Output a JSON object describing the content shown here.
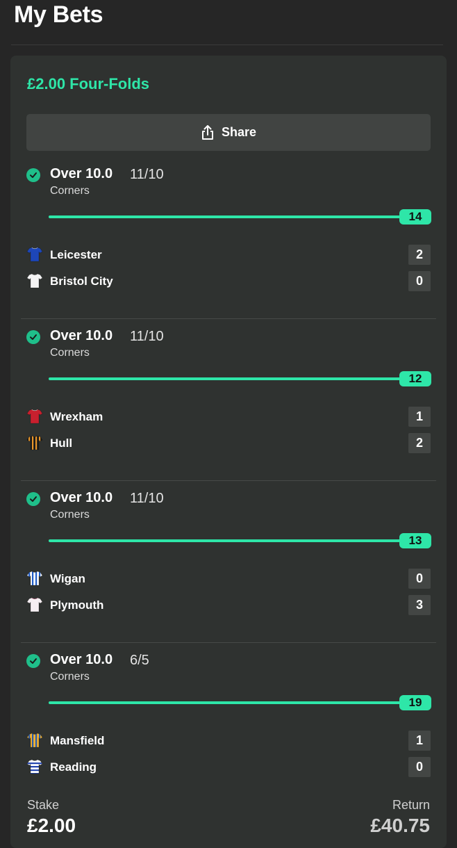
{
  "page": {
    "title": "My Bets"
  },
  "bet": {
    "title": "£2.00 Four-Folds",
    "share_label": "Share",
    "legs": [
      {
        "selection": "Over 10.0",
        "odds": "11/10",
        "market": "Corners",
        "stat_value": "14",
        "progress_fraction": 1.0,
        "teams": [
          {
            "name": "Leicester",
            "score": "2",
            "shirt": {
              "type": "solid",
              "primary": "#1d46b8",
              "secondary": "#ffffff"
            }
          },
          {
            "name": "Bristol City",
            "score": "0",
            "shirt": {
              "type": "solid",
              "primary": "#f4f4f4",
              "secondary": "#c0c0c0"
            }
          }
        ]
      },
      {
        "selection": "Over 10.0",
        "odds": "11/10",
        "market": "Corners",
        "stat_value": "12",
        "progress_fraction": 1.0,
        "teams": [
          {
            "name": "Wrexham",
            "score": "1",
            "shirt": {
              "type": "solid",
              "primary": "#c8202e",
              "secondary": "#ffffff"
            }
          },
          {
            "name": "Hull",
            "score": "2",
            "shirt": {
              "type": "stripes",
              "primary": "#1a1a1a",
              "secondary": "#e8962a"
            }
          }
        ]
      },
      {
        "selection": "Over 10.0",
        "odds": "11/10",
        "market": "Corners",
        "stat_value": "13",
        "progress_fraction": 1.0,
        "teams": [
          {
            "name": "Wigan",
            "score": "0",
            "shirt": {
              "type": "stripes",
              "primary": "#ffffff",
              "secondary": "#1e5bc6"
            }
          },
          {
            "name": "Plymouth",
            "score": "3",
            "shirt": {
              "type": "solid",
              "primary": "#f6eef2",
              "secondary": "#d06a8e"
            }
          }
        ]
      },
      {
        "selection": "Over 10.0",
        "odds": "6/5",
        "market": "Corners",
        "stat_value": "19",
        "progress_fraction": 1.0,
        "teams": [
          {
            "name": "Mansfield",
            "score": "1",
            "shirt": {
              "type": "stripes",
              "primary": "#f2b130",
              "secondary": "#2a5aa8"
            }
          },
          {
            "name": "Reading",
            "score": "0",
            "shirt": {
              "type": "hoops",
              "primary": "#ffffff",
              "secondary": "#2446b0"
            }
          }
        ]
      }
    ],
    "stake_label": "Stake",
    "stake_value": "£2.00",
    "return_label": "Return",
    "return_value": "£40.75"
  },
  "colors": {
    "accent": "#2ee6a8",
    "background": "#262626",
    "card": "#2f3230"
  }
}
